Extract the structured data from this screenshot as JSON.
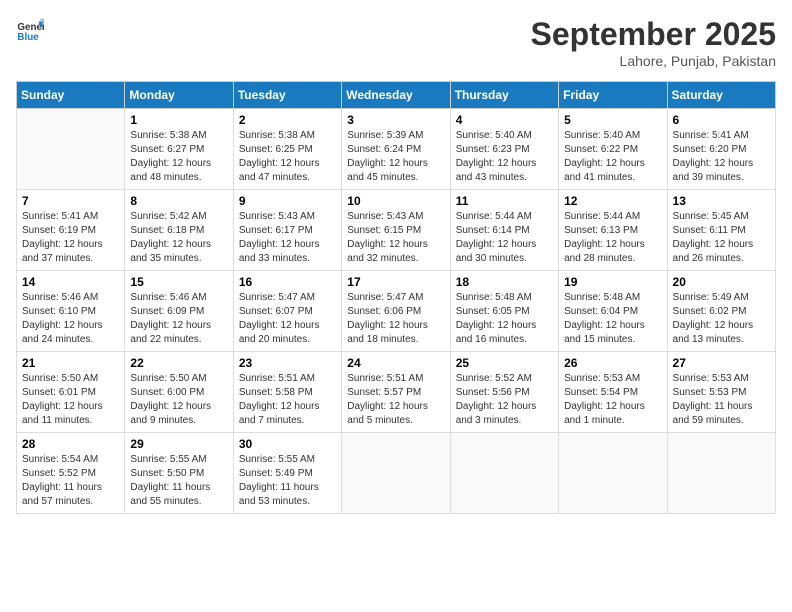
{
  "header": {
    "logo_line1": "General",
    "logo_line2": "Blue",
    "month": "September 2025",
    "location": "Lahore, Punjab, Pakistan"
  },
  "days_of_week": [
    "Sunday",
    "Monday",
    "Tuesday",
    "Wednesday",
    "Thursday",
    "Friday",
    "Saturday"
  ],
  "weeks": [
    [
      {
        "day": "",
        "sunrise": "",
        "sunset": "",
        "daylight": ""
      },
      {
        "day": "1",
        "sunrise": "Sunrise: 5:38 AM",
        "sunset": "Sunset: 6:27 PM",
        "daylight": "Daylight: 12 hours and 48 minutes."
      },
      {
        "day": "2",
        "sunrise": "Sunrise: 5:38 AM",
        "sunset": "Sunset: 6:25 PM",
        "daylight": "Daylight: 12 hours and 47 minutes."
      },
      {
        "day": "3",
        "sunrise": "Sunrise: 5:39 AM",
        "sunset": "Sunset: 6:24 PM",
        "daylight": "Daylight: 12 hours and 45 minutes."
      },
      {
        "day": "4",
        "sunrise": "Sunrise: 5:40 AM",
        "sunset": "Sunset: 6:23 PM",
        "daylight": "Daylight: 12 hours and 43 minutes."
      },
      {
        "day": "5",
        "sunrise": "Sunrise: 5:40 AM",
        "sunset": "Sunset: 6:22 PM",
        "daylight": "Daylight: 12 hours and 41 minutes."
      },
      {
        "day": "6",
        "sunrise": "Sunrise: 5:41 AM",
        "sunset": "Sunset: 6:20 PM",
        "daylight": "Daylight: 12 hours and 39 minutes."
      }
    ],
    [
      {
        "day": "7",
        "sunrise": "Sunrise: 5:41 AM",
        "sunset": "Sunset: 6:19 PM",
        "daylight": "Daylight: 12 hours and 37 minutes."
      },
      {
        "day": "8",
        "sunrise": "Sunrise: 5:42 AM",
        "sunset": "Sunset: 6:18 PM",
        "daylight": "Daylight: 12 hours and 35 minutes."
      },
      {
        "day": "9",
        "sunrise": "Sunrise: 5:43 AM",
        "sunset": "Sunset: 6:17 PM",
        "daylight": "Daylight: 12 hours and 33 minutes."
      },
      {
        "day": "10",
        "sunrise": "Sunrise: 5:43 AM",
        "sunset": "Sunset: 6:15 PM",
        "daylight": "Daylight: 12 hours and 32 minutes."
      },
      {
        "day": "11",
        "sunrise": "Sunrise: 5:44 AM",
        "sunset": "Sunset: 6:14 PM",
        "daylight": "Daylight: 12 hours and 30 minutes."
      },
      {
        "day": "12",
        "sunrise": "Sunrise: 5:44 AM",
        "sunset": "Sunset: 6:13 PM",
        "daylight": "Daylight: 12 hours and 28 minutes."
      },
      {
        "day": "13",
        "sunrise": "Sunrise: 5:45 AM",
        "sunset": "Sunset: 6:11 PM",
        "daylight": "Daylight: 12 hours and 26 minutes."
      }
    ],
    [
      {
        "day": "14",
        "sunrise": "Sunrise: 5:46 AM",
        "sunset": "Sunset: 6:10 PM",
        "daylight": "Daylight: 12 hours and 24 minutes."
      },
      {
        "day": "15",
        "sunrise": "Sunrise: 5:46 AM",
        "sunset": "Sunset: 6:09 PM",
        "daylight": "Daylight: 12 hours and 22 minutes."
      },
      {
        "day": "16",
        "sunrise": "Sunrise: 5:47 AM",
        "sunset": "Sunset: 6:07 PM",
        "daylight": "Daylight: 12 hours and 20 minutes."
      },
      {
        "day": "17",
        "sunrise": "Sunrise: 5:47 AM",
        "sunset": "Sunset: 6:06 PM",
        "daylight": "Daylight: 12 hours and 18 minutes."
      },
      {
        "day": "18",
        "sunrise": "Sunrise: 5:48 AM",
        "sunset": "Sunset: 6:05 PM",
        "daylight": "Daylight: 12 hours and 16 minutes."
      },
      {
        "day": "19",
        "sunrise": "Sunrise: 5:48 AM",
        "sunset": "Sunset: 6:04 PM",
        "daylight": "Daylight: 12 hours and 15 minutes."
      },
      {
        "day": "20",
        "sunrise": "Sunrise: 5:49 AM",
        "sunset": "Sunset: 6:02 PM",
        "daylight": "Daylight: 12 hours and 13 minutes."
      }
    ],
    [
      {
        "day": "21",
        "sunrise": "Sunrise: 5:50 AM",
        "sunset": "Sunset: 6:01 PM",
        "daylight": "Daylight: 12 hours and 11 minutes."
      },
      {
        "day": "22",
        "sunrise": "Sunrise: 5:50 AM",
        "sunset": "Sunset: 6:00 PM",
        "daylight": "Daylight: 12 hours and 9 minutes."
      },
      {
        "day": "23",
        "sunrise": "Sunrise: 5:51 AM",
        "sunset": "Sunset: 5:58 PM",
        "daylight": "Daylight: 12 hours and 7 minutes."
      },
      {
        "day": "24",
        "sunrise": "Sunrise: 5:51 AM",
        "sunset": "Sunset: 5:57 PM",
        "daylight": "Daylight: 12 hours and 5 minutes."
      },
      {
        "day": "25",
        "sunrise": "Sunrise: 5:52 AM",
        "sunset": "Sunset: 5:56 PM",
        "daylight": "Daylight: 12 hours and 3 minutes."
      },
      {
        "day": "26",
        "sunrise": "Sunrise: 5:53 AM",
        "sunset": "Sunset: 5:54 PM",
        "daylight": "Daylight: 12 hours and 1 minute."
      },
      {
        "day": "27",
        "sunrise": "Sunrise: 5:53 AM",
        "sunset": "Sunset: 5:53 PM",
        "daylight": "Daylight: 11 hours and 59 minutes."
      }
    ],
    [
      {
        "day": "28",
        "sunrise": "Sunrise: 5:54 AM",
        "sunset": "Sunset: 5:52 PM",
        "daylight": "Daylight: 11 hours and 57 minutes."
      },
      {
        "day": "29",
        "sunrise": "Sunrise: 5:55 AM",
        "sunset": "Sunset: 5:50 PM",
        "daylight": "Daylight: 11 hours and 55 minutes."
      },
      {
        "day": "30",
        "sunrise": "Sunrise: 5:55 AM",
        "sunset": "Sunset: 5:49 PM",
        "daylight": "Daylight: 11 hours and 53 minutes."
      },
      {
        "day": "",
        "sunrise": "",
        "sunset": "",
        "daylight": ""
      },
      {
        "day": "",
        "sunrise": "",
        "sunset": "",
        "daylight": ""
      },
      {
        "day": "",
        "sunrise": "",
        "sunset": "",
        "daylight": ""
      },
      {
        "day": "",
        "sunrise": "",
        "sunset": "",
        "daylight": ""
      }
    ]
  ]
}
